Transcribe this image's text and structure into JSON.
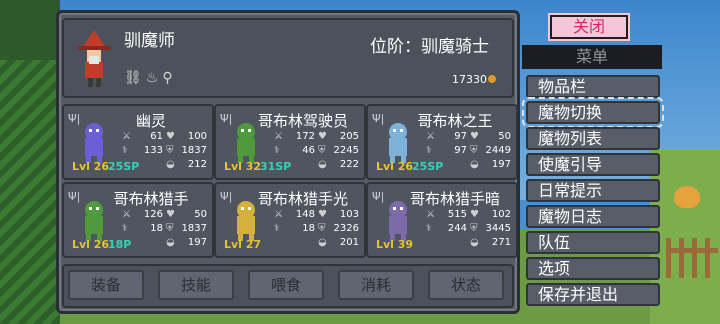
{
  "hero": {
    "class_name": "驯魔师",
    "rank_label": "位阶：驯魔骑士",
    "gold": "17330",
    "status_icons": "⛓♨⚲"
  },
  "monsters": [
    {
      "name": "幽灵",
      "atk": "61",
      "hp": "100",
      "def": "133",
      "hp2": "1837",
      "lvl": "Lvl 26",
      "sp": "25SP",
      "food": "212",
      "color": "#6b5fd6"
    },
    {
      "name": "哥布林驾驶员",
      "atk": "172",
      "hp": "205",
      "def": "46",
      "hp2": "2245",
      "lvl": "Lvl 32",
      "sp": "31SP",
      "food": "222",
      "color": "#4f9a3d"
    },
    {
      "name": "哥布林之王",
      "atk": "97",
      "hp": "50",
      "def": "97",
      "hp2": "2449",
      "lvl": "Lvl 26",
      "sp": "25SP",
      "food": "197",
      "color": "#7fb2d8"
    },
    {
      "name": "哥布林猎手",
      "atk": "126",
      "hp": "50",
      "def": "18",
      "hp2": "1837",
      "lvl": "Lvl 26",
      "sp": "18P",
      "food": "197",
      "color": "#4f9a3d"
    },
    {
      "name": "哥布林猎手光",
      "atk": "148",
      "hp": "103",
      "def": "18",
      "hp2": "2326",
      "lvl": "Lvl 27",
      "sp": "",
      "food": "201",
      "color": "#d4b13a"
    },
    {
      "name": "哥布林猎手暗",
      "atk": "515",
      "hp": "102",
      "def": "244",
      "hp2": "3445",
      "lvl": "Lvl 39",
      "sp": "",
      "food": "271",
      "color": "#7d6aa8"
    }
  ],
  "actions": [
    "装备",
    "技能",
    "喂食",
    "消耗",
    "状态"
  ],
  "menu": {
    "close_label": "关闭",
    "title": "菜单",
    "items": [
      "物品栏",
      "魔物切换",
      "魔物列表",
      "使魔引导",
      "日常提示",
      "魔物日志",
      "队伍",
      "选项",
      "保存并退出"
    ],
    "selected_index": 1
  }
}
